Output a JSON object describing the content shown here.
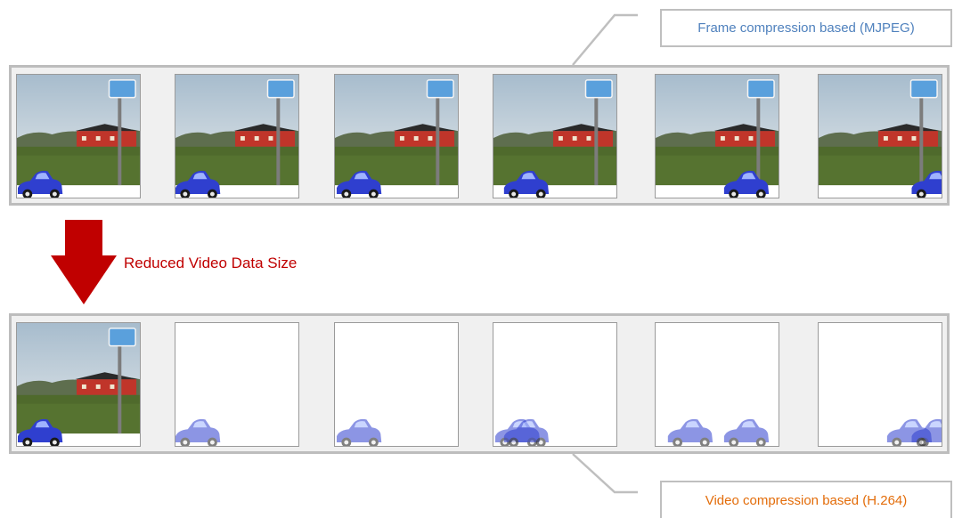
{
  "top_callout": {
    "label": "Frame compression based (MJPEG)"
  },
  "bottom_callout": {
    "label": "Video compression based (H.264)"
  },
  "arrow": {
    "label": "Reduced Video Data Size"
  },
  "colors": {
    "top_label": "#4f81bd",
    "bottom_label": "#e36c09",
    "arrow": "#c00000",
    "arrow_label": "#c00000",
    "strip_background": "#f0f0f0",
    "strip_border": "#bdbdbd",
    "car": "#2f3fcf"
  },
  "mjpeg_frames": [
    {
      "content": "full-scene"
    },
    {
      "content": "full-scene"
    },
    {
      "content": "full-scene"
    },
    {
      "content": "full-scene"
    },
    {
      "content": "full-scene"
    },
    {
      "content": "full-scene"
    }
  ],
  "h264_frames": [
    {
      "content": "full-scene (key frame)"
    },
    {
      "content": "car motion only"
    },
    {
      "content": "car motion only"
    },
    {
      "content": "car motion only"
    },
    {
      "content": "car motion only"
    },
    {
      "content": "car motion only"
    }
  ]
}
